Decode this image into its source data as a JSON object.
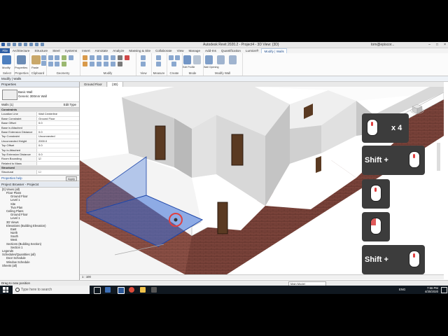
{
  "app": {
    "title": "Autodesk Revit 2020.2 - Project4 - 3D View: {3D}",
    "user": "tom@episcor...",
    "window_controls": [
      "–",
      "□",
      "×"
    ]
  },
  "menu_tabs": [
    "File",
    "Architecture",
    "Structure",
    "Steel",
    "Systems",
    "Insert",
    "Annotate",
    "Analyze",
    "Massing & Site",
    "Collaborate",
    "View",
    "Manage",
    "Add-Ins",
    "Quantification",
    "Lumion®",
    "Modify | Walls"
  ],
  "ribbon": {
    "groups": [
      "Select",
      "Properties",
      "Clipboard",
      "Geometry",
      "Modify",
      "View",
      "Measure",
      "Create",
      "Mode",
      "Modify Wall"
    ],
    "buttons": {
      "modify": "Modify",
      "properties": "Properties",
      "paste": "Paste",
      "cut": "Cut",
      "join": "Join",
      "edit_profile": "Edit Profile",
      "reset_profile": "Reset Profile",
      "wall_opening": "Wall Opening",
      "attach": "Attach Top/Base",
      "detach": "Detach Top/Base"
    }
  },
  "context_bar": "Modify | Walls",
  "properties": {
    "header": "Properties",
    "type_name": "Basic Wall",
    "type_sub": "Generic 300mm Wall",
    "instance_label": "Walls (1)",
    "edit_type": "Edit Type",
    "rows": [
      {
        "cat": "Constraints"
      },
      {
        "k": "Location Line",
        "v": "Wall Centerline"
      },
      {
        "k": "Base Constraint",
        "v": "Ground Floor"
      },
      {
        "k": "Base Offset",
        "v": "0.0"
      },
      {
        "k": "Base is Attached",
        "v": ""
      },
      {
        "k": "Base Extension Distance",
        "v": "0.0"
      },
      {
        "k": "Top Constraint",
        "v": "Unconnected"
      },
      {
        "k": "Unconnected Height",
        "v": "2000.0"
      },
      {
        "k": "Top Offset",
        "v": "0.0"
      },
      {
        "k": "Top is Attached",
        "v": ""
      },
      {
        "k": "Top Extension Distance",
        "v": "0.0"
      },
      {
        "k": "Room Bounding",
        "v": "☑"
      },
      {
        "k": "Related to Mass",
        "v": ""
      },
      {
        "cat": "Structural"
      },
      {
        "k": "Structural",
        "v": "☐"
      }
    ],
    "help": "Properties help",
    "apply": "Apply"
  },
  "browser": {
    "header": "Project Browser - Project4",
    "nodes": [
      {
        "t": "[0] Views (all)",
        "d": 0
      },
      {
        "t": "Floor Plans",
        "d": 1
      },
      {
        "t": "Ground Floor",
        "d": 2
      },
      {
        "t": "Level 1",
        "d": 2
      },
      {
        "t": "Site",
        "d": 2
      },
      {
        "t": "Tiva Plan",
        "d": 2
      },
      {
        "t": "Ceiling Plans",
        "d": 1
      },
      {
        "t": "Ground Floor",
        "d": 2
      },
      {
        "t": "Level 1",
        "d": 2
      },
      {
        "t": "3D Views",
        "d": 1
      },
      {
        "t": "Elevations (Building Elevation)",
        "d": 1
      },
      {
        "t": "East",
        "d": 2
      },
      {
        "t": "North",
        "d": 2
      },
      {
        "t": "South",
        "d": 2
      },
      {
        "t": "West",
        "d": 2
      },
      {
        "t": "Sections (Building Section)",
        "d": 1
      },
      {
        "t": "Section 1",
        "d": 2
      },
      {
        "t": "Legends",
        "d": 0
      },
      {
        "t": "Schedules/Quantities (all)",
        "d": 0
      },
      {
        "t": "Door Schedule",
        "d": 1
      },
      {
        "t": "Window Schedule",
        "d": 1
      },
      {
        "t": "Sheets (all)",
        "d": 0
      }
    ]
  },
  "view_tabs": [
    "Ground Floor",
    "{3D}"
  ],
  "view_bar": {
    "scale": "1 : 100"
  },
  "status": {
    "left": "Drag to new position",
    "main_model": "Main Model"
  },
  "overlay": {
    "tiles": [
      {
        "label": "x 4",
        "kind": "wheel"
      },
      {
        "label": "Shift  +",
        "kind": "wheel"
      },
      {
        "label": "",
        "kind": "wheel"
      },
      {
        "label": "",
        "kind": "left"
      },
      {
        "label": "Shift  +",
        "kind": "wheel"
      }
    ],
    "accent": "#e13f3f"
  },
  "taskbar": {
    "search_placeholder": "Type here to search",
    "lang": "ENG",
    "time": "7:56 PM",
    "date": "4/30/2020"
  },
  "colors": {
    "file_tab": "#2e5fa5",
    "brick": "#8a4f45",
    "selection": "#3a6fd8"
  }
}
